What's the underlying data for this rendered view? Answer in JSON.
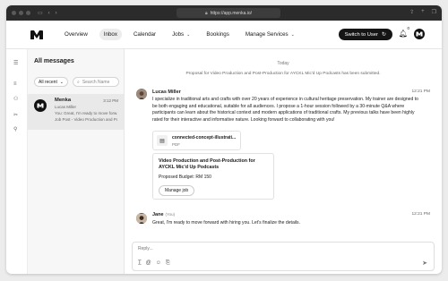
{
  "browser": {
    "url": "https://app.menka.io/"
  },
  "nav": {
    "items": [
      "Overview",
      "Inbox",
      "Calendar",
      "Jobs",
      "Bookings",
      "Manage Services"
    ],
    "active": "Inbox",
    "switch_label": "Switch to User",
    "notifications": "0"
  },
  "sidebar": {
    "title": "All messages",
    "filter_value": "All recent",
    "search_placeholder": "Search Name",
    "conversation": {
      "name": "Menka",
      "time": "3:12 PM",
      "subtitle": "Lucas Miller",
      "preview": "You: Great, I'm ready to move forw...",
      "job": "Job Post - Video Production and Post-..."
    }
  },
  "chat": {
    "day_label": "Today",
    "system_message": "Proposal for Video Production and Post-Production for AYCKL Mic'd Up Podcasts has been submitted.",
    "messages": [
      {
        "sender": "Lucas Miller",
        "time": "12:21 PM",
        "text": "I specialize in traditional arts and crafts with over 20 years of experience in cultural heritage preservation. My trainer are designed to be both engaging and educational, suitable for all audiences. I propose a 1-hour session followed by a 30-minute Q&A where participants can learn about the historical context and modern applications of traditional crafts. My previous talks have been highly rated for their interactive and informative nature. Looking forward to collaborating with you!"
      },
      {
        "sender": "Jane",
        "you_tag": "(You)",
        "time": "12:21 PM",
        "text": "Great, I'm ready to move forward with hiring you. Let's finalize the details."
      }
    ],
    "attachment": {
      "name": "connected-concept-illustrati...",
      "type": "PDF"
    },
    "job_card": {
      "title": "Video Production and Post-Production for AYCKL Mic'd Up Podcasts",
      "budget": "Proposed Budget: RM 150",
      "button": "Manage job"
    },
    "composer_placeholder": "Reply..."
  }
}
